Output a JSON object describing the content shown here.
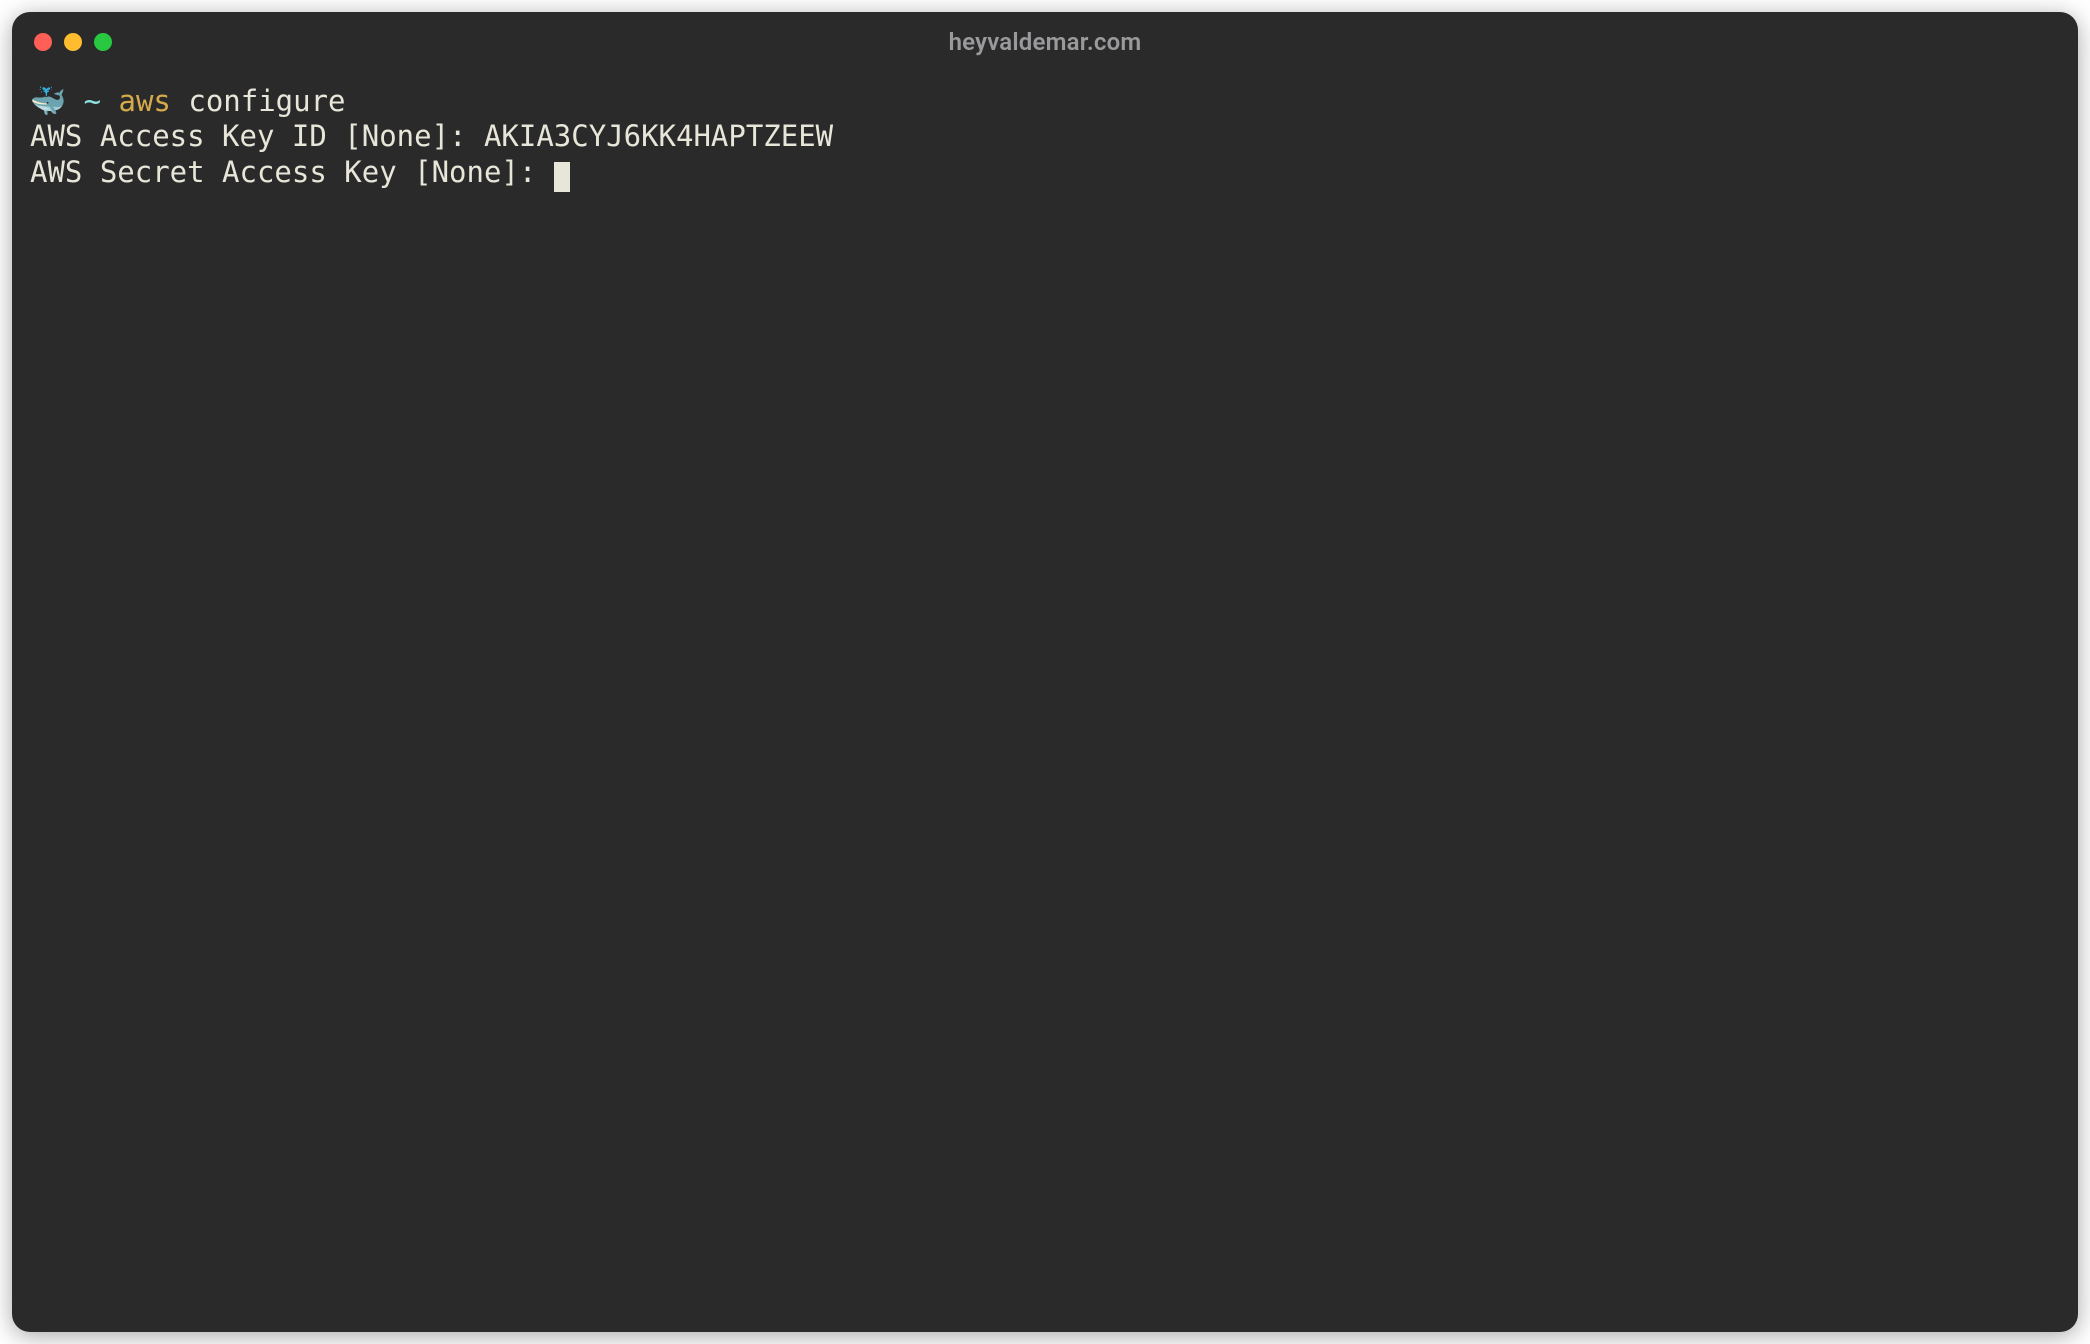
{
  "window": {
    "title": "heyvaldemar.com"
  },
  "prompt": {
    "icon": "🐳",
    "tilde": "~",
    "command": "aws",
    "argument": "configure"
  },
  "lines": {
    "access_key_label": "AWS Access Key ID [None]: ",
    "access_key_value": "AKIA3CYJ6KK4HAPTZEEW",
    "secret_key_label": "AWS Secret Access Key [None]: "
  }
}
